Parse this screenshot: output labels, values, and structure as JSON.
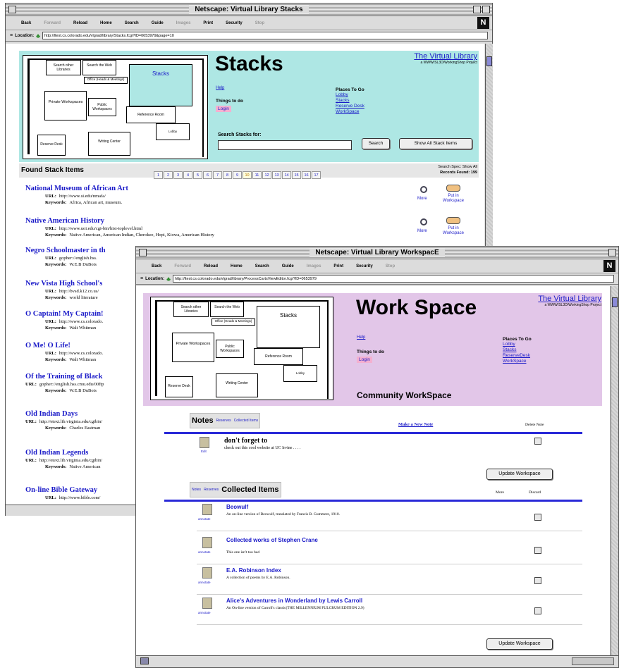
{
  "stacks_window": {
    "title": "Netscape: Virtual Library Stacks",
    "toolbar": [
      "Back",
      "Forward",
      "Reload",
      "Home",
      "Search",
      "Guide",
      "Images",
      "Print",
      "Security",
      "Stop"
    ],
    "location_label": "Location:",
    "url": "http://ltest.cs.colorado.edu/vlgrad/library/Stacks.fcgi?ID=0653979&page=10",
    "page_title": "Stacks",
    "vl_title": "The Virtual Library",
    "vl_sub": "a WWW/SL3D/WorkingShop Project",
    "help": "Help",
    "things_to_do": "Things to do",
    "login": "Login",
    "places_to_go": "Places To Go",
    "places": [
      "Lobby",
      "Stacks",
      "Reserve Desk",
      "WorkSpace"
    ],
    "search_label": "Search Stacks for:",
    "search_value": "",
    "search_button": "Search",
    "show_all_button": "Show All Stack Items",
    "found_label": "Found Stack Items",
    "pages": [
      "1",
      "2",
      "3",
      "4",
      "5",
      "6",
      "7",
      "8",
      "9",
      "10",
      "11",
      "12",
      "13",
      "14",
      "15",
      "16",
      "17"
    ],
    "search_spec": "Search Spec: Show All",
    "records_found": "Records Found: 199",
    "url_label": "URL:",
    "keywords_label": "Keywords:",
    "more_label": "More",
    "put_label": "Put in Workspace",
    "map_rooms": {
      "search_libs": "Search other Libraries",
      "search_web": "Search the Web",
      "stacks": "Stacks",
      "office": "Office (Heads & Meetings)",
      "private": "Private Workspaces",
      "public": "Public Workspaces",
      "reference": "Reference Room",
      "reserve": "Reserve Desk",
      "writing": "Writing Center",
      "lobby": "Lobby"
    },
    "items": [
      {
        "title": "National Museum of African Art",
        "url": "http://www.si.edu/nmafa/",
        "keywords": "Africa, African art, museum."
      },
      {
        "title": "Native American History",
        "url": "http://www.uoi.edu/cgi-bin/hist-toplevel.html",
        "keywords": "Native American, American Indian, Cherokee, Hopi, Kiowa, American History"
      },
      {
        "title": "Negro Schoolmaster in th",
        "url": "gopher://english.hss.",
        "keywords": "W.E.B DuBois"
      },
      {
        "title": "New Vista High School's ",
        "url": "http://bvsd.k12.co.us/",
        "keywords": "world literature"
      },
      {
        "title": "O Captain! My Captain!",
        "url": "http://www.cs.colorado.",
        "keywords": "Walt Whitman"
      },
      {
        "title": "O Me! O Life!",
        "url": "http://www.cs.colorado.",
        "keywords": "Walt Whitman"
      },
      {
        "title": "Of the Training of Black ",
        "url": "gopher://english.hss.cmu.edu/00ftp",
        "keywords": "W.E.B DuBois"
      },
      {
        "title": "Old Indian Days",
        "url": "http://etext.lib.virginia.edu/cgibin/",
        "keywords": "Charles Eastman"
      },
      {
        "title": "Old Indian Legends",
        "url": "http://etext.lib.virginia.edu/cgibin/",
        "keywords": "Native American"
      },
      {
        "title": "On-line Bible Gateway",
        "url": "http://www.bible.com/",
        "keywords": ""
      }
    ]
  },
  "workspace_window": {
    "title": "Netscape: Virtual Library WorkspacE",
    "toolbar": [
      "Back",
      "Forward",
      "Reload",
      "Home",
      "Search",
      "Guide",
      "Images",
      "Print",
      "Security",
      "Stop"
    ],
    "location_label": "Location:",
    "url": "http://ltest.cs.colorado.edu/vlgrad/library/ProcessCartsViewEditor.fcgi?ID=0653979",
    "page_title": "Work Space",
    "vl_title": "The Virtual Library",
    "vl_sub": "a WWW/SL3D/WorkingShop Project",
    "help": "Help",
    "things_to_do": "Things to do",
    "login": "Login",
    "places_to_go": "Places To Go",
    "places": [
      "Lobby",
      "Stacks",
      "ReserveDesk",
      "WorkSpace"
    ],
    "community": "Community WorkSpace",
    "tabs_notes": {
      "active": "Notes",
      "others": [
        "Reserves",
        "Collected Items"
      ]
    },
    "make_note": "Make a New Note",
    "delete_note": "Delete Note",
    "note": {
      "title": "don't forget to",
      "body": "check out this cool website at UC Irvine . . . .",
      "icon_label": "Edit"
    },
    "update_button": "Update Workspace",
    "tabs_items": {
      "others": [
        "Notes",
        "Reserves"
      ],
      "active": "Collected Items"
    },
    "more_col": "More",
    "discard_col": "Discard",
    "collected": [
      {
        "title": "Beowulf",
        "desc": "An on-line version of Beowulf, translated by Francis B. Gummere, 1910.",
        "icon_label": "annotate"
      },
      {
        "title": "Collected works of Stephen Crane",
        "desc": "This one isn't too bad",
        "icon_label": "annotate"
      },
      {
        "title": "E.A. Robinson Index",
        "desc": "A collection of poems by E.A. Robinson.",
        "icon_label": "annotate"
      },
      {
        "title": "Alice's Adventures in Wonderland by Lewis Carroll",
        "desc": "An On-line version of Carroll's classic(THE MILLENNIUM FULCRUM EDITION 2.9)",
        "icon_label": "annotate"
      }
    ]
  },
  "colors": {
    "stacks_header": "#aee7e4",
    "workspace_header": "#e2c6e8",
    "link": "#1a1ac8",
    "nav_blue": "#1a1ac8"
  }
}
